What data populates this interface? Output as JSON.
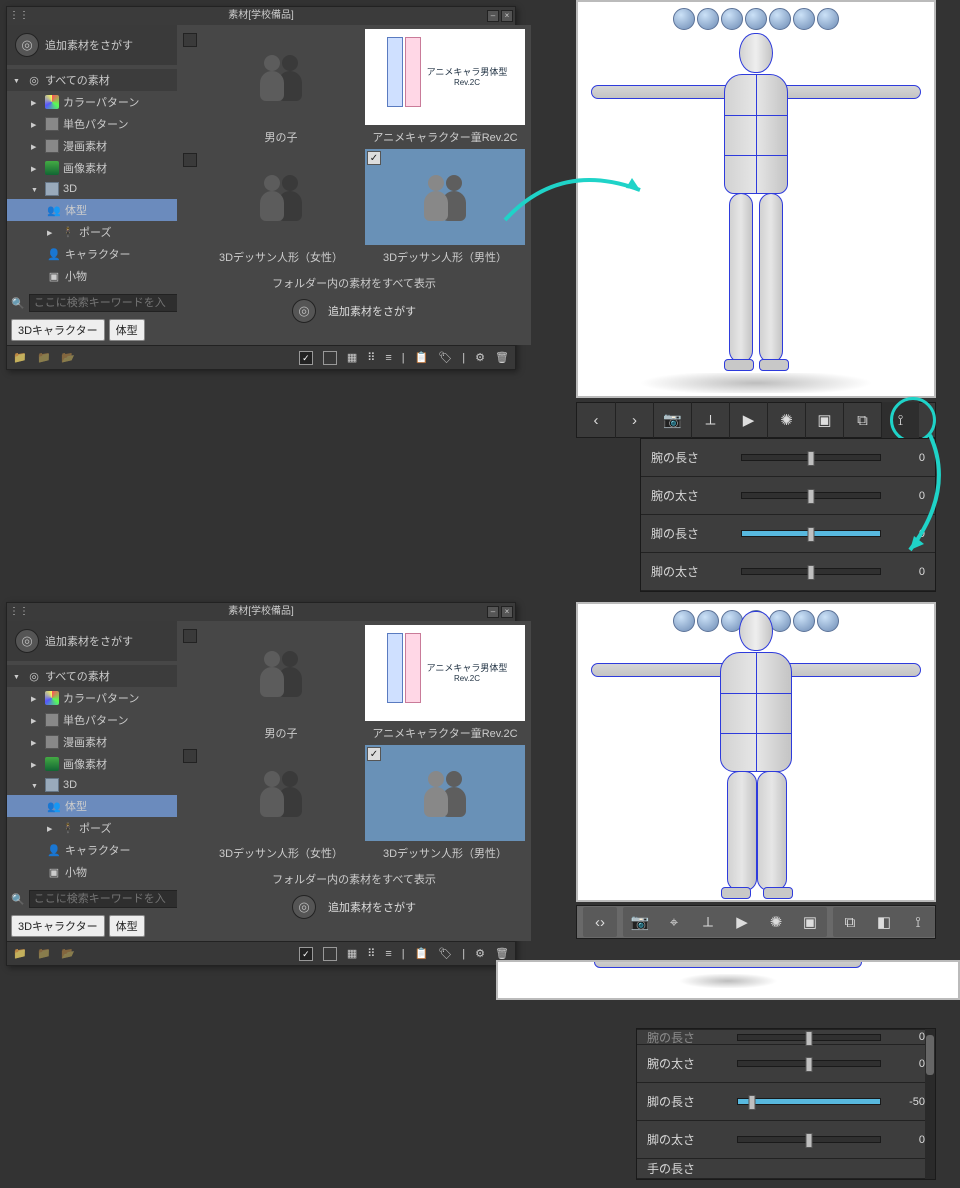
{
  "panel": {
    "title": "素材[学校備品]",
    "search_btn_label": "追加素材をさがす",
    "tree": {
      "all": "すべての素材",
      "color_pattern": "カラーパターン",
      "mono_pattern": "単色パターン",
      "manga": "漫画素材",
      "image": "画像素材",
      "d3": "3D",
      "body": "体型",
      "pose": "ポーズ",
      "character": "キャラクター",
      "props": "小物"
    },
    "search_placeholder": "ここに検索キーワードを入",
    "tags": {
      "t1": "3Dキャラクター",
      "t2": "体型"
    },
    "thumbs": {
      "boy": "男の子",
      "anime": "アニメキャラクター童Rev.2C",
      "anime_card": "アニメキャラ男体型",
      "anime_ver": "Rev.2C",
      "female": "3Dデッサン人形（女性）",
      "male": "3Dデッサン人形（男性）"
    },
    "show_all": "フォルダー内の素材をすべて表示",
    "more": "追加素材をさがす"
  },
  "sliders1": {
    "r1": {
      "label": "腕の長さ",
      "value": "0"
    },
    "r2": {
      "label": "腕の太さ",
      "value": "0"
    },
    "r3": {
      "label": "脚の長さ",
      "value": "0"
    },
    "r4": {
      "label": "脚の太さ",
      "value": "0"
    }
  },
  "sliders2": {
    "r0": {
      "label": "腕の長さ",
      "value": "0"
    },
    "r1": {
      "label": "腕の太さ",
      "value": "0"
    },
    "r2": {
      "label": "脚の長さ",
      "value": "-50"
    },
    "r3": {
      "label": "脚の太さ",
      "value": "0"
    },
    "r4": {
      "label": "手の長さ"
    }
  }
}
